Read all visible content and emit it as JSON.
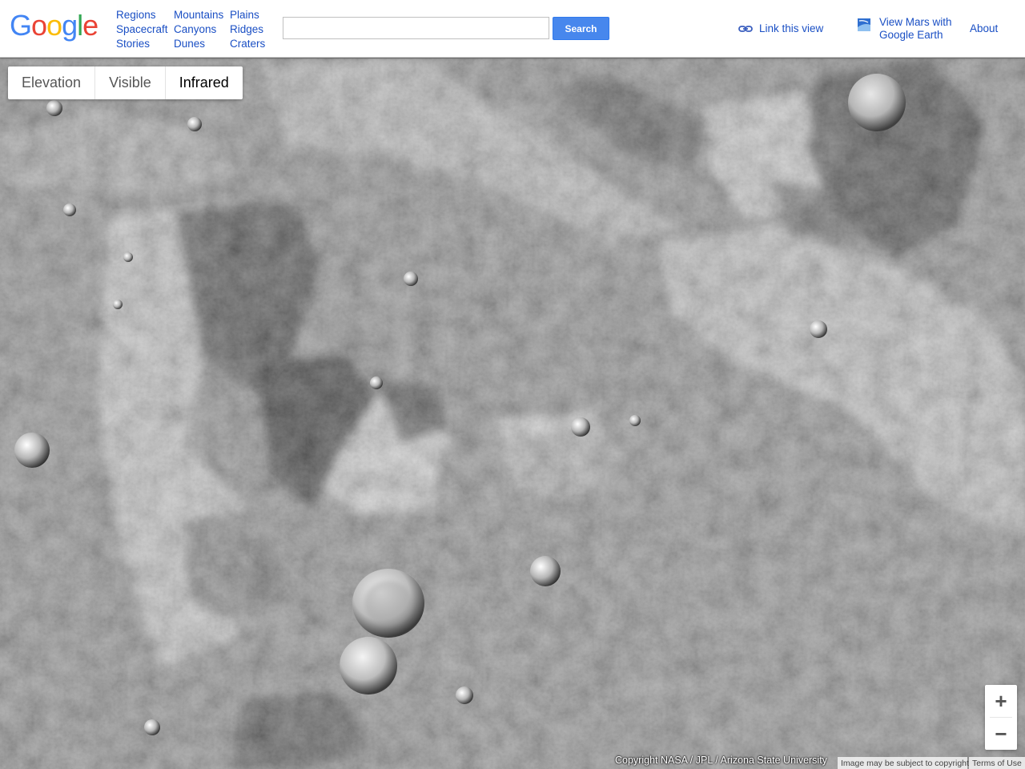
{
  "logo": {
    "letters": [
      "G",
      "o",
      "o",
      "g",
      "l",
      "e"
    ],
    "colors": [
      "#4285f4",
      "#ea4335",
      "#fbbc05",
      "#4285f4",
      "#34a853",
      "#ea4335"
    ]
  },
  "nav": {
    "col1": [
      "Regions",
      "Spacecraft",
      "Stories"
    ],
    "col2": [
      "Mountains",
      "Canyons",
      "Dunes"
    ],
    "col3": [
      "Plains",
      "Ridges",
      "Craters"
    ]
  },
  "search": {
    "value": "",
    "button": "Search"
  },
  "header_links": {
    "link_view": "Link this view",
    "earth_line1": "View Mars with",
    "earth_line2": "Google Earth",
    "about": "About"
  },
  "layers": {
    "items": [
      "Elevation",
      "Visible",
      "Infrared"
    ],
    "active": "Infrared"
  },
  "zoom": {
    "in": "+",
    "out": "−"
  },
  "footer": {
    "copyright": "Copyright NASA / JPL / Arizona State University",
    "notice": "Image may be subject to copyright",
    "terms": "Terms of Use"
  },
  "colors": {
    "link": "#1a4fc4",
    "search_button": "#4787ed"
  }
}
